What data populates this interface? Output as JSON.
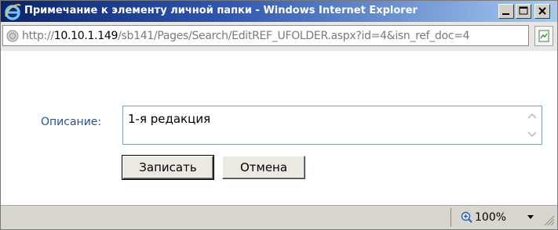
{
  "window": {
    "title": "Примечание к элементу личной папки - Windows Internet Explorer"
  },
  "address": {
    "scheme": "http://",
    "host": "10.10.1.149",
    "path": "/sb141/Pages/Search/EditREF_UFOLDER.aspx?id=4&isn_ref_doc=4"
  },
  "form": {
    "description_label": "Описание:",
    "description_value": "1-я редакция",
    "save_label": "Записать",
    "cancel_label": "Отмена"
  },
  "statusbar": {
    "zoom": "100%"
  },
  "colors": {
    "title_start": "#0a246a",
    "title_end": "#a6caf0",
    "label": "#2a4f9c"
  },
  "icons": [
    "ie-logo-icon",
    "minimize-icon",
    "maximize-icon",
    "close-icon",
    "page-icon",
    "compatibility-view-icon",
    "scroll-up-icon",
    "scroll-down-icon",
    "zoom-icon",
    "dropdown-arrow-icon",
    "resize-grip-icon"
  ]
}
